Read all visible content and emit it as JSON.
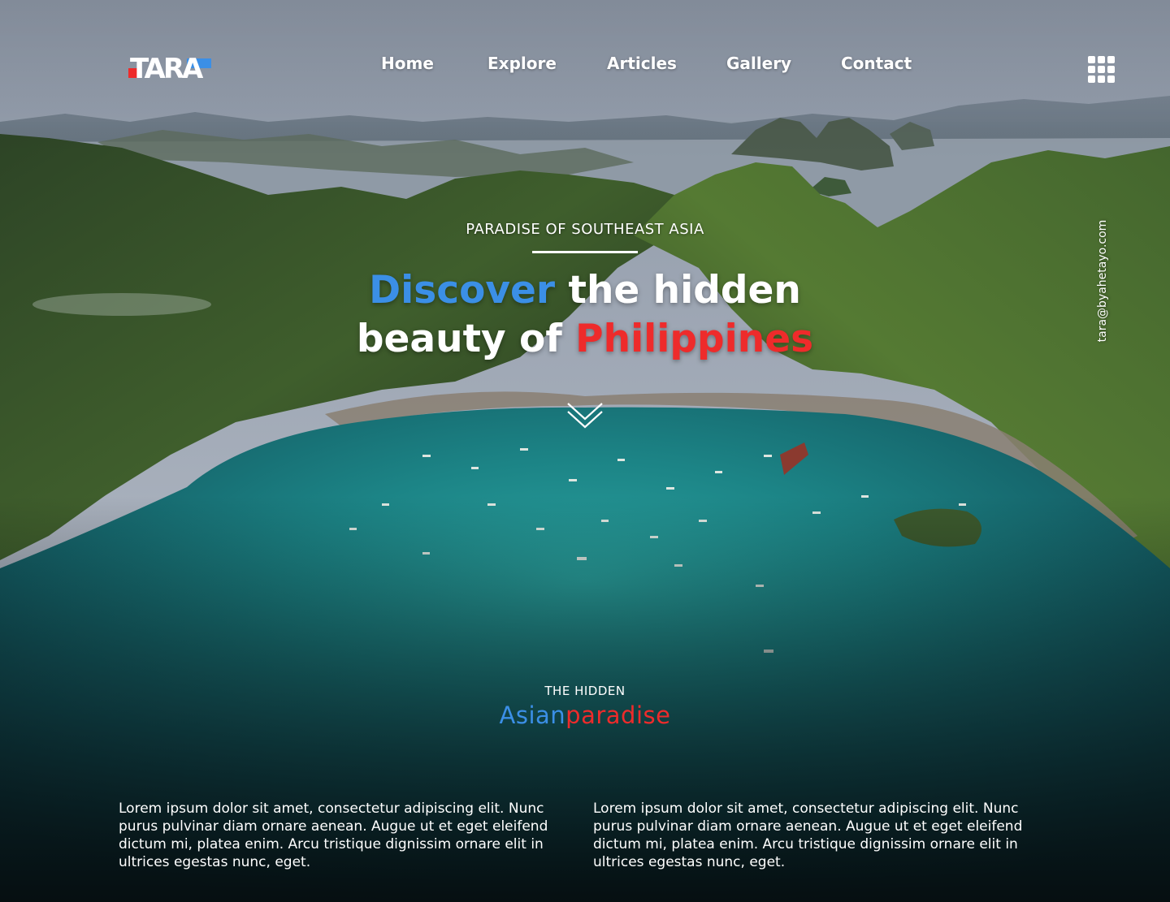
{
  "brand": {
    "logo_text": "TARA",
    "colors": {
      "blue": "#3b8fe6",
      "red": "#ee2b2b",
      "white": "#ffffff"
    }
  },
  "nav": {
    "items": [
      {
        "label": "Home"
      },
      {
        "label": "Explore"
      },
      {
        "label": "Articles"
      },
      {
        "label": "Gallery"
      },
      {
        "label": "Contact"
      }
    ],
    "menu_icon": "grid-menu-icon"
  },
  "side": {
    "email": "tara@byahetayo.com"
  },
  "hero": {
    "eyebrow": "PARADISE OF SOUTHEAST ASIA",
    "headline": {
      "word_discover": "Discover",
      "part_1": " the hidden",
      "part_2": "beauty of ",
      "word_philippines": "Philippines"
    },
    "scroll_icon": "chevron-double-down-icon"
  },
  "section": {
    "eyebrow": "THE HIDDEN",
    "title_blue": "Asian",
    "title_red": "paradise"
  },
  "content": {
    "paragraphs": [
      "Lorem ipsum dolor sit amet, consectetur adipiscing elit. Nunc purus pulvinar diam ornare aenean. Augue ut et eget eleifend dictum mi, platea enim. Arcu tristique dignissim ornare elit in ultrices egestas nunc, eget.",
      "Lorem ipsum dolor sit amet, consectetur adipiscing elit. Nunc purus pulvinar diam ornare aenean. Augue ut et eget eleifend dictum mi, platea enim. Arcu tristique dignissim ornare elit in ultrices egestas nunc, eget."
    ]
  }
}
